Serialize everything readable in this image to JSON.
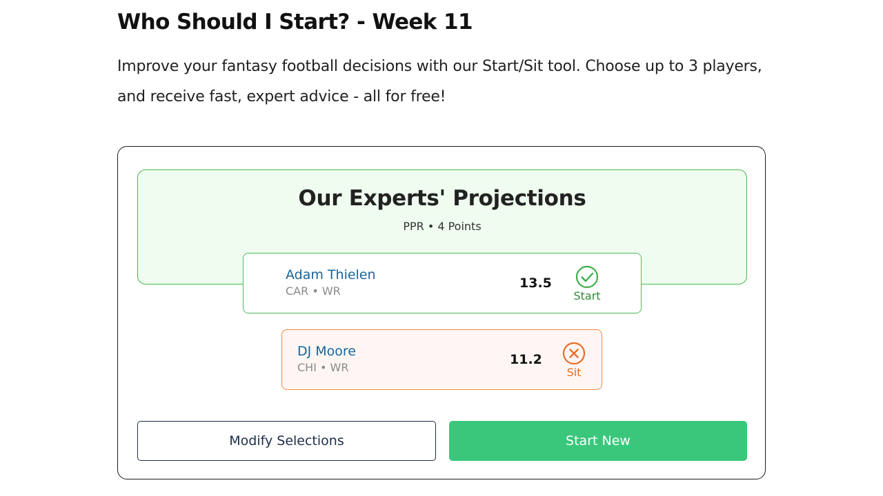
{
  "page": {
    "title": "Who Should I Start? - Week 11",
    "intro": "Improve your fantasy football decisions with our Start/Sit tool. Choose up to 3 players, and receive fast, expert advice - all for free!"
  },
  "projections": {
    "title": "Our Experts' Projections",
    "scoring": "PPR • 4 Points"
  },
  "players": [
    {
      "name": "Adam Thielen",
      "meta": "CAR • WR",
      "points": "13.5",
      "verdict": "Start",
      "verdict_icon": "check-circle-icon",
      "color": "#4cb85a"
    },
    {
      "name": "DJ Moore",
      "meta": "CHI • WR",
      "points": "11.2",
      "verdict": "Sit",
      "verdict_icon": "x-circle-icon",
      "color": "#ec8a45"
    }
  ],
  "actions": {
    "modify_label": "Modify Selections",
    "new_label": "Start New"
  },
  "colors": {
    "accent_green": "#3ac77b",
    "panel_border": "#49b84c",
    "panel_bg": "#effcef",
    "sit_orange": "#ec8a45",
    "link_blue": "#17649a"
  }
}
